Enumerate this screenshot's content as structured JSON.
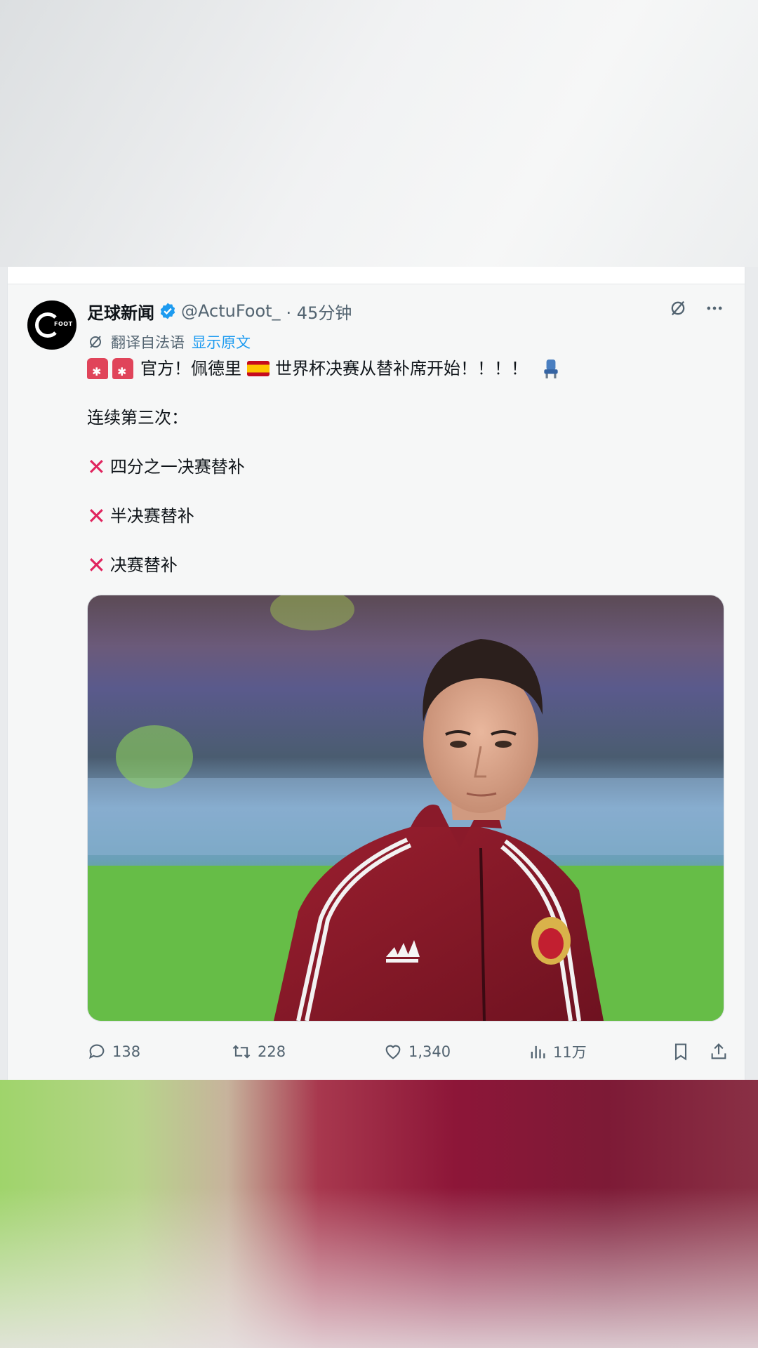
{
  "tweet": {
    "author_name": "足球新闻",
    "author_handle": "@ActuFoot_",
    "time": "· 45分钟",
    "translate_note": "翻译自法语",
    "show_original": "显示原文",
    "line1": "官方！佩德里",
    "line1b": "世界杯决赛从替补席开始！！！！",
    "line2": "连续第三次：",
    "item1": "四分之一决赛替补",
    "item2": "半决赛替补",
    "item3": "决赛替补"
  },
  "actions": {
    "replies": "138",
    "retweets": "228",
    "likes": "1,340",
    "views": "11万"
  },
  "icons": [
    "grok-icon",
    "more-icon",
    "verified-badge-icon",
    "translate-icon",
    "siren-emoji",
    "spain-flag-emoji",
    "seat-emoji",
    "cross-mark-icon",
    "reply-icon",
    "retweet-icon",
    "like-icon",
    "views-icon",
    "bookmark-icon",
    "share-icon"
  ],
  "colors": {
    "accent": "#1d9bf0",
    "cross": "#e0245e",
    "text": "#0f1419",
    "muted": "#536471"
  }
}
